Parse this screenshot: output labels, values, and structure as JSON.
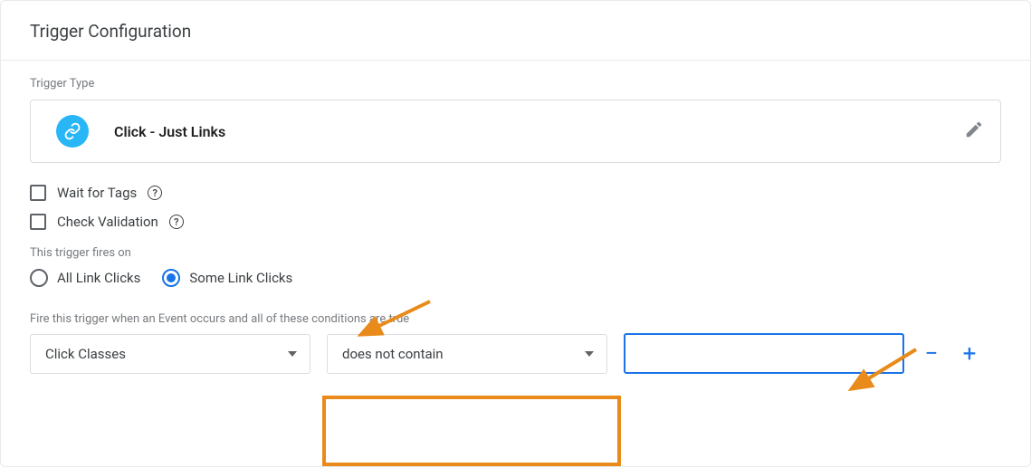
{
  "header": {
    "title": "Trigger Configuration"
  },
  "trigger_type": {
    "section_label": "Trigger Type",
    "value": "Click - Just Links",
    "icon": "link-icon"
  },
  "options": {
    "wait_for_tags_label": "Wait for Tags",
    "wait_for_tags_checked": false,
    "check_validation_label": "Check Validation",
    "check_validation_checked": false
  },
  "fires_on": {
    "label": "This trigger fires on",
    "options": [
      {
        "label": "All Link Clicks",
        "value": "all",
        "checked": false
      },
      {
        "label": "Some Link Clicks",
        "value": "some",
        "checked": true
      }
    ]
  },
  "condition": {
    "label": "Fire this trigger when an Event occurs and all of these conditions are true",
    "variable": "Click Classes",
    "operator": "does not contain",
    "value": ""
  },
  "buttons": {
    "remove": "−",
    "add": "+"
  }
}
